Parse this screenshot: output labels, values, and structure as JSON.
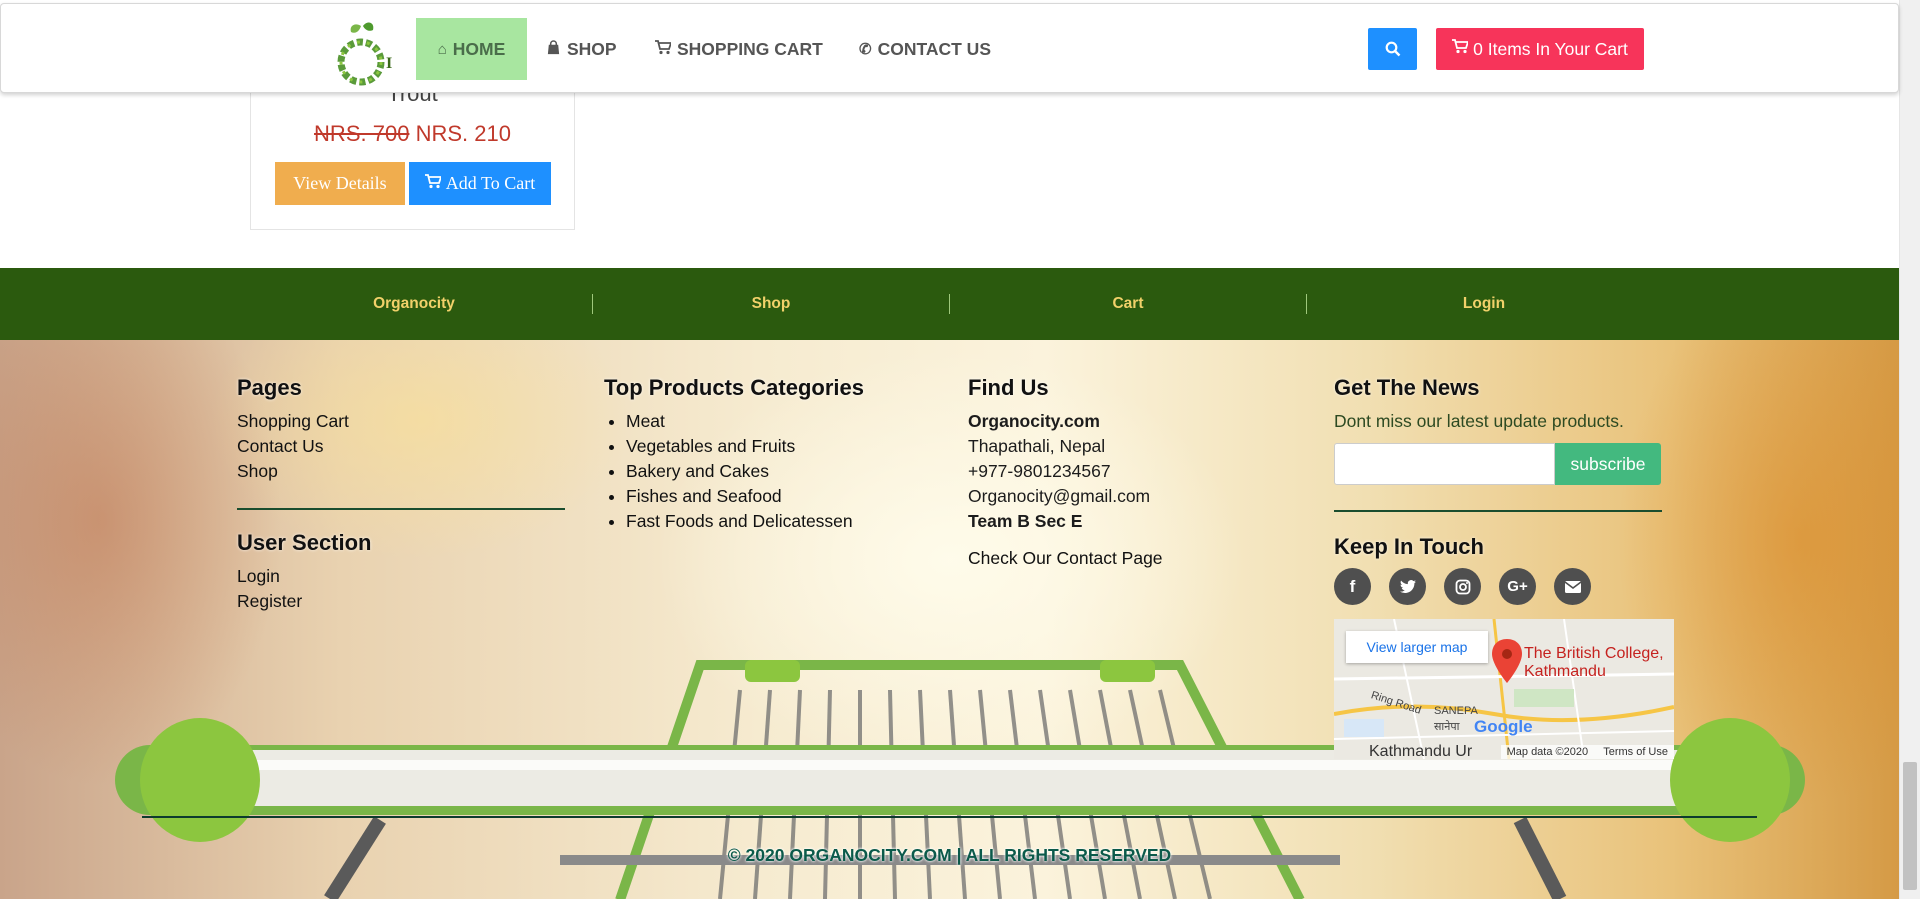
{
  "navbar": {
    "items": [
      {
        "label": "HOME",
        "icon": "home-icon",
        "active": true
      },
      {
        "label": "SHOP",
        "icon": "shopping-bag-icon"
      },
      {
        "label": "SHOPPING CART",
        "icon": "cart-icon"
      },
      {
        "label": "CONTACT US",
        "icon": "phone-icon"
      }
    ],
    "cart_button": "0 Items In Your Cart",
    "colors": {
      "home_active": "#a8e6a0",
      "search": "#1e90ff",
      "cart": "#f7345a"
    }
  },
  "product": {
    "name": "Trout",
    "old_price": "NRS. 700",
    "new_price": "NRS. 210",
    "view_details": "View Details",
    "add_to_cart": "Add To Cart"
  },
  "footer_nav": {
    "items": [
      "Organocity",
      "Shop",
      "Cart",
      "Login"
    ],
    "background": "#2b5a0e"
  },
  "footer": {
    "pages": {
      "title": "Pages",
      "links": [
        "Shopping Cart",
        "Contact Us",
        "Shop"
      ]
    },
    "user_section": {
      "title": "User Section",
      "links": [
        "Login",
        "Register"
      ]
    },
    "categories": {
      "title": "Top Products Categories",
      "items": [
        "Meat",
        "Vegetables and Fruits",
        "Bakery and Cakes",
        "Fishes and Seafood",
        "Fast Foods and Delicatessen"
      ]
    },
    "find_us": {
      "title": "Find Us",
      "company": "Organocity.com",
      "address": "Thapathali, Nepal",
      "phone": "+977-9801234567",
      "email": "Organocity@gmail.com",
      "team": "Team B Sec E",
      "contact_link": "Check Our Contact Page"
    },
    "news": {
      "title": "Get The News",
      "text": "Dont miss our latest update products.",
      "input_value": "",
      "subscribe": "subscribe"
    },
    "keep_in_touch": {
      "title": "Keep In Touch",
      "social": [
        "facebook-icon",
        "twitter-icon",
        "instagram-icon",
        "google-plus-icon",
        "envelope-icon"
      ]
    },
    "map": {
      "view_larger": "View larger map",
      "place": "The British College, Kathmandu",
      "place_line1": "The British College,",
      "place_line2": "Kathmandu",
      "ring_road": "Ring Road",
      "sanepa": "SANEPA",
      "sanepa_local": "सानेपा",
      "google": "Google",
      "attribution": "Map data ©2020",
      "terms": "Terms of Use",
      "partial_label": "Kathmandu Ur"
    },
    "copyright": "© 2020 ORGANOCITY.COM | ALL RIGHTS RESERVED"
  }
}
